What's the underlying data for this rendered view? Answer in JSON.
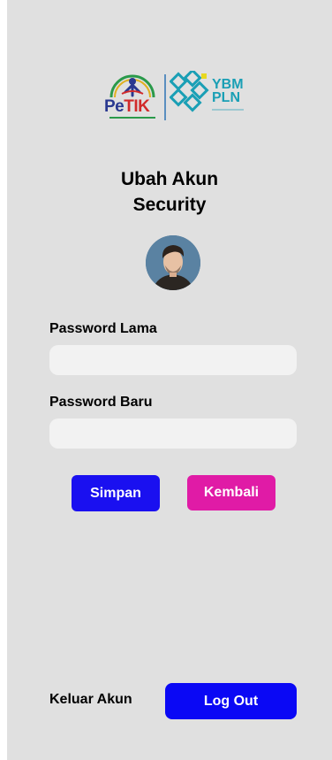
{
  "logos": {
    "petik_part1": "Pe",
    "petik_part2": "TIK",
    "ybm_line1": "YBM",
    "ybm_line2": "PLN"
  },
  "header": {
    "title_line1": "Ubah Akun",
    "title_line2": "Security"
  },
  "form": {
    "old_password_label": "Password Lama",
    "old_password_value": "",
    "new_password_label": "Password Baru",
    "new_password_value": ""
  },
  "actions": {
    "save_label": "Simpan",
    "back_label": "Kembali"
  },
  "footer": {
    "logout_prompt": "Keluar Akun",
    "logout_label": "Log Out"
  },
  "colors": {
    "save_button": "#1a10f0",
    "back_button": "#e01ba6",
    "logout_button": "#0a08f5",
    "background": "#e0e0e0",
    "input_fill": "#f2f2f2"
  }
}
